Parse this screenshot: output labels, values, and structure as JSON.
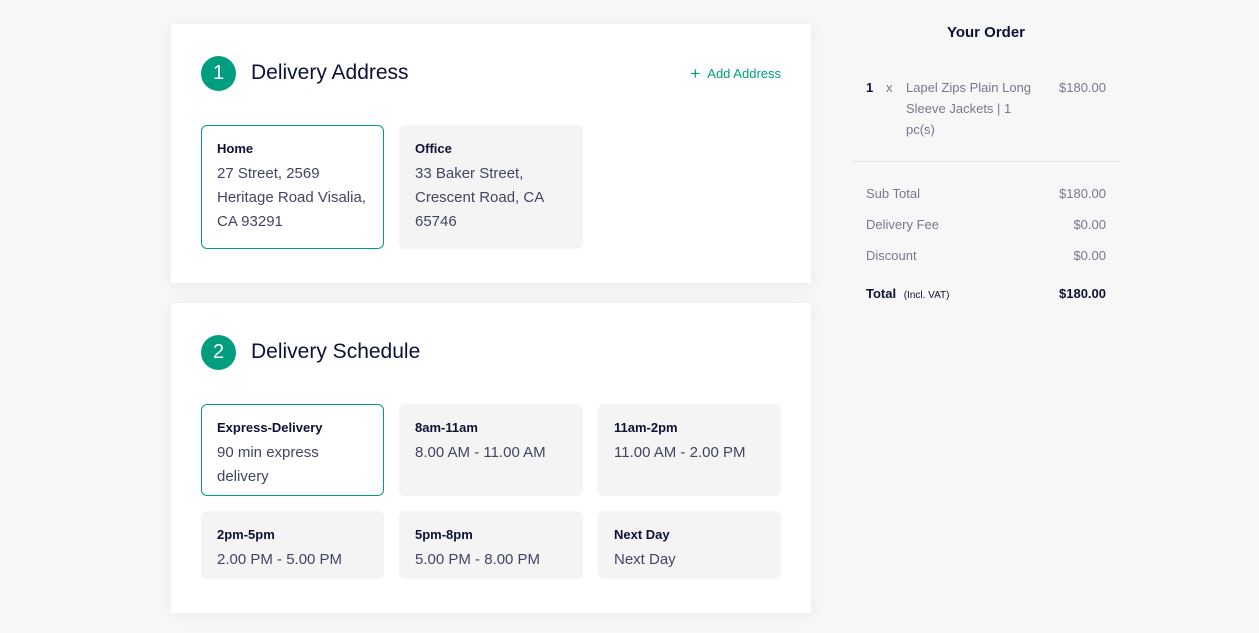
{
  "colors": {
    "accent": "#009e7f",
    "text_dark": "#0d1136",
    "text_muted": "#77798c",
    "option_bg": "#f4f4f4"
  },
  "address_section": {
    "step": "1",
    "title": "Delivery Address",
    "add_label": "Add Address",
    "add_icon": "plus-icon",
    "addresses": [
      {
        "name": "Home",
        "text": "27 Street, 2569 Heritage Road Visalia, CA 93291",
        "selected": true
      },
      {
        "name": "Office",
        "text": "33 Baker Street, Crescent Road, CA 65746",
        "selected": false
      }
    ]
  },
  "schedule_section": {
    "step": "2",
    "title": "Delivery Schedule",
    "slots": [
      {
        "title": "Express-Delivery",
        "text": "90 min express delivery",
        "selected": true
      },
      {
        "title": "8am-11am",
        "text": "8.00 AM - 11.00 AM",
        "selected": false
      },
      {
        "title": "11am-2pm",
        "text": "11.00 AM - 2.00 PM",
        "selected": false
      },
      {
        "title": "2pm-5pm",
        "text": "2.00 PM - 5.00 PM",
        "selected": false
      },
      {
        "title": "5pm-8pm",
        "text": "5.00 PM - 8.00 PM",
        "selected": false
      },
      {
        "title": "Next Day",
        "text": "Next Day",
        "selected": false
      }
    ]
  },
  "order": {
    "title": "Your Order",
    "items": [
      {
        "qty": "1",
        "x": "x",
        "name": "Lapel Zips Plain Long Sleeve Jackets | 1 pc(s)",
        "price": "$180.00"
      }
    ],
    "sub_total_label": "Sub Total",
    "sub_total": "$180.00",
    "delivery_fee_label": "Delivery Fee",
    "delivery_fee": "$0.00",
    "discount_label": "Discount",
    "discount": "$0.00",
    "total_label": "Total",
    "total_note": "(Incl. VAT)",
    "total": "$180.00"
  }
}
